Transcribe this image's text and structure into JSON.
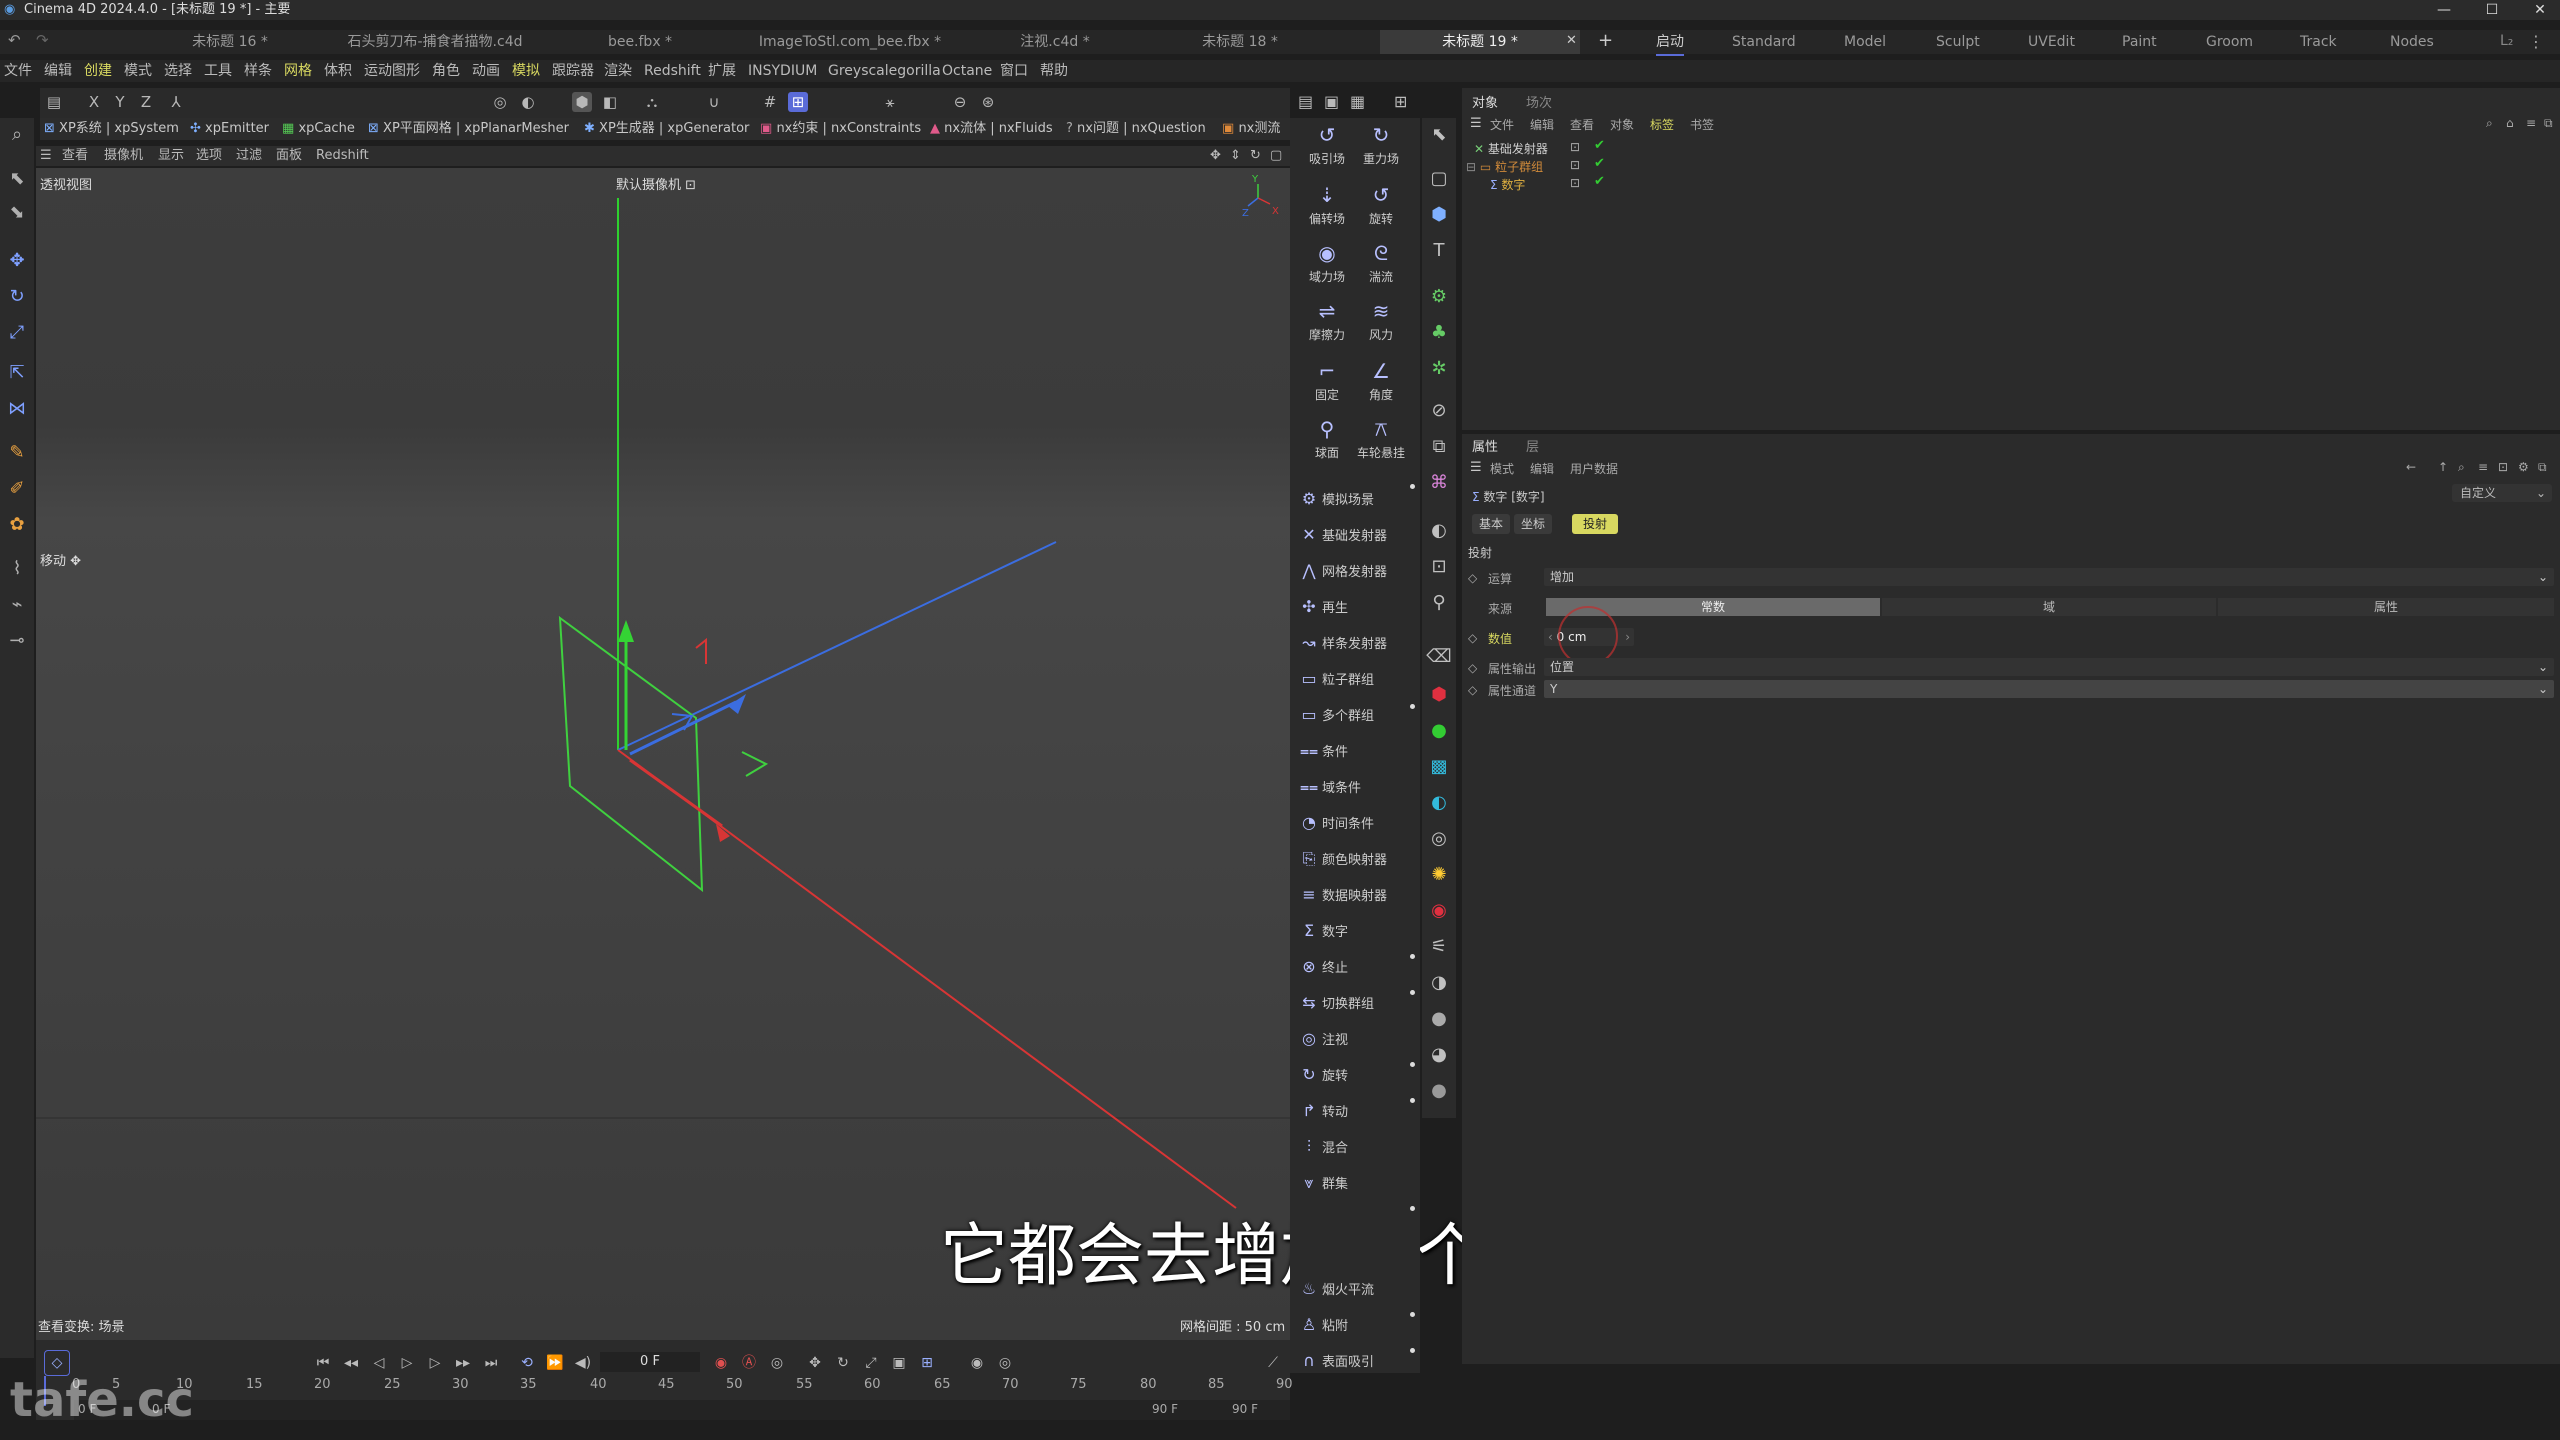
{
  "window": {
    "title": "Cinema 4D 2024.4.0 - [未标题 19 *] - 主要"
  },
  "doc_tabs": [
    "未标题 16 *",
    "石头剪刀布-捕食者描物.c4d",
    "bee.fbx *",
    "ImageToStl.com_bee.fbx *",
    "注视.c4d *",
    "未标题 18 *",
    "未标题 19 *"
  ],
  "layouts": [
    "启动",
    "Standard",
    "Model",
    "Sculpt",
    "UVEdit",
    "Paint",
    "Groom",
    "Track",
    "Nodes"
  ],
  "menu": [
    "文件",
    "编辑",
    "创建",
    "模式",
    "选择",
    "工具",
    "样条",
    "网格",
    "体积",
    "运动图形",
    "角色",
    "动画",
    "模拟",
    "跟踪器",
    "渲染",
    "Redshift",
    "扩展",
    "INSYDIUM",
    "Greyscalegorilla",
    "Octane",
    "窗口",
    "帮助"
  ],
  "plugins": [
    "XP系统 | xpSystem",
    "xpEmitter",
    "xpCache",
    "XP平面网格 | xpPlanarMesher",
    "XP生成器 | xpGenerator",
    "nx约束 | nxConstraints",
    "nx流体 | nxFluids",
    "nx问题 | nxQuestion",
    "nx测流"
  ],
  "viewport": {
    "menu": [
      "查看",
      "摄像机",
      "显示",
      "选项",
      "过滤",
      "面板",
      "Redshift"
    ],
    "view_name": "透视视图",
    "camera": "默认摄像机",
    "move_label": "移动",
    "status_left": "查看变换: 场景",
    "grid_spacing": "网格间距 : 50 cm"
  },
  "palette_top": [
    {
      "label": "吸引场",
      "icon": "attractor-icon"
    },
    {
      "label": "重力场",
      "icon": "gravity-icon"
    },
    {
      "label": "偏转场",
      "icon": "deflector-icon"
    },
    {
      "label": "旋转",
      "icon": "rotation-icon"
    },
    {
      "label": "域力场",
      "icon": "field-force-icon"
    },
    {
      "label": "湍流",
      "icon": "turbulence-icon"
    },
    {
      "label": "摩擦力",
      "icon": "friction-icon"
    },
    {
      "label": "风力",
      "icon": "wind-icon"
    },
    {
      "label": "固定",
      "icon": "fixed-icon"
    },
    {
      "label": "角度",
      "icon": "angle-icon"
    },
    {
      "label": "球面",
      "icon": "sphere-icon"
    },
    {
      "label": "车轮悬挂",
      "icon": "wheel-suspension-icon"
    }
  ],
  "palette_list": [
    "模拟场景",
    "基础发射器",
    "网格发射器",
    "再生",
    "样条发射器",
    "粒子群组",
    "多个群组",
    "条件",
    "域条件",
    "时间条件",
    "颜色映射器",
    "数据映射器",
    "数字",
    "终止",
    "切换群组",
    "注视",
    "旋转",
    "转动",
    "混合",
    "群集",
    "烟火平流",
    "粘附",
    "表面吸引"
  ],
  "object_manager": {
    "tabs": [
      "对象",
      "场次"
    ],
    "menu": [
      "文件",
      "编辑",
      "查看",
      "对象",
      "标签",
      "书签"
    ],
    "items": [
      {
        "name": "基础发射器",
        "icon": "emitter-icon",
        "color": "#d0d0d0"
      },
      {
        "name": "粒子群组",
        "icon": "group-icon",
        "color": "#d08a3a"
      },
      {
        "name": "数字",
        "icon": "sigma-icon",
        "color": "#e0b040"
      }
    ]
  },
  "attributes": {
    "tabs": [
      "属性",
      "层"
    ],
    "menu": [
      "模式",
      "编辑",
      "用户数据"
    ],
    "object_title": "数字 [数字]",
    "preset": "自定义",
    "sub_tabs": [
      "基本",
      "坐标",
      "投射"
    ],
    "section": "投射",
    "fields": {
      "operation_label": "运算",
      "operation_value": "增加",
      "source_label": "来源",
      "source_options": [
        "常数",
        "域",
        "属性"
      ],
      "value_label": "数值",
      "value_text": "0 cm",
      "attr_output_label": "属性输出",
      "attr_output_value": "位置",
      "attr_channel_label": "属性通道",
      "attr_channel_value": "Y"
    }
  },
  "timeline": {
    "frame": "0 F",
    "ticks": [
      "0",
      "5",
      "10",
      "15",
      "20",
      "25",
      "30",
      "35",
      "40",
      "45",
      "50",
      "55",
      "60",
      "65",
      "70",
      "75",
      "80",
      "85",
      "90"
    ],
    "start": "0 F",
    "start2": "0 F",
    "end1": "90 F",
    "end2": "90 F"
  },
  "subtitle": "它都会去增加这个数值",
  "watermark": "tafe.cc",
  "colors": {
    "accent": "#5a6bd8",
    "active_tab": "#d8d860",
    "x_axis": "#d83030",
    "y_axis": "#30c030",
    "z_axis": "#3070e0"
  }
}
